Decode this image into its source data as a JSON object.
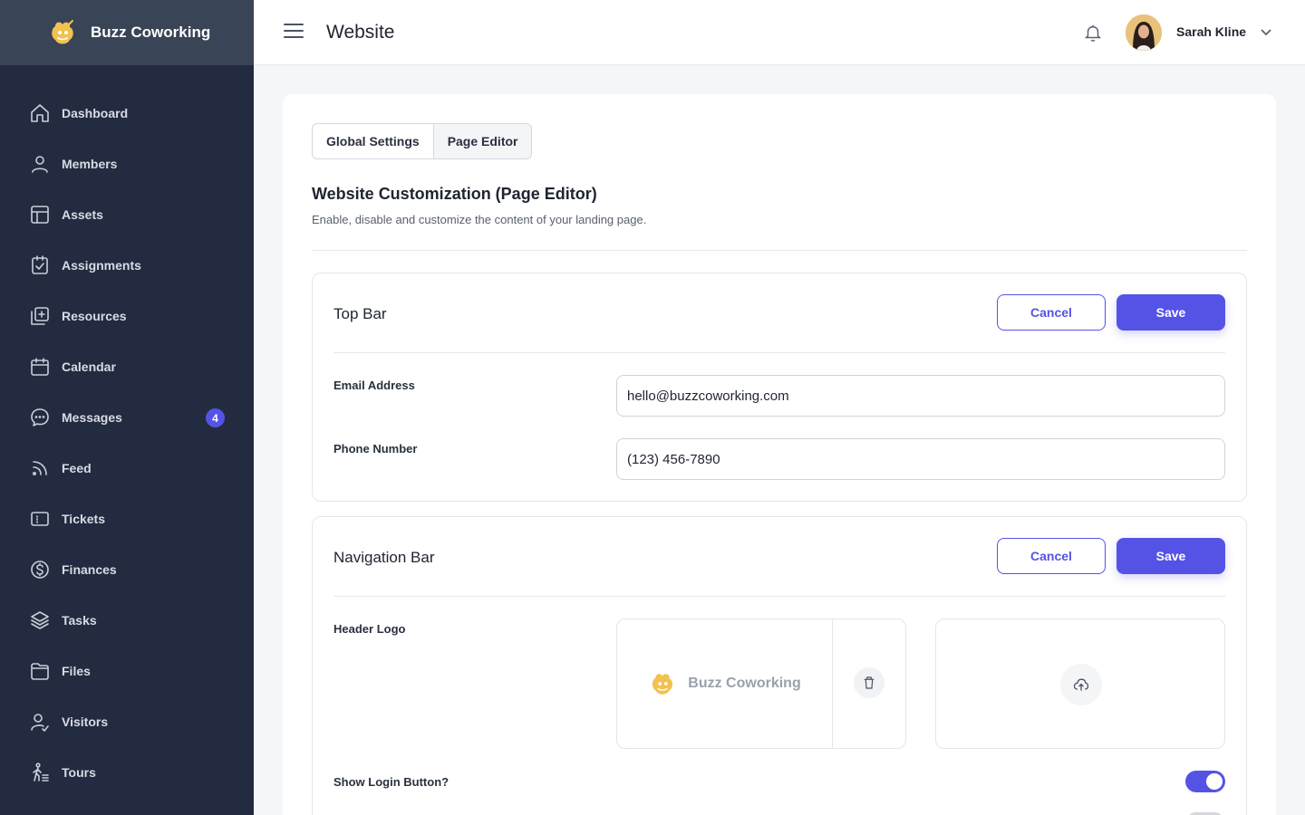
{
  "brand": {
    "name": "Buzz Coworking",
    "logo_icon": "bee-logo-icon",
    "accent_color": "#F2C14E"
  },
  "sidebar": {
    "items": [
      {
        "label": "Dashboard",
        "icon": "home-icon"
      },
      {
        "label": "Members",
        "icon": "user-icon"
      },
      {
        "label": "Assets",
        "icon": "layout-icon"
      },
      {
        "label": "Assignments",
        "icon": "clipboard-check-icon"
      },
      {
        "label": "Resources",
        "icon": "add-stack-icon"
      },
      {
        "label": "Calendar",
        "icon": "calendar-icon"
      },
      {
        "label": "Messages",
        "icon": "chat-icon",
        "badge": "4"
      },
      {
        "label": "Feed",
        "icon": "rss-icon"
      },
      {
        "label": "Tickets",
        "icon": "ticket-icon"
      },
      {
        "label": "Finances",
        "icon": "dollar-icon"
      },
      {
        "label": "Tasks",
        "icon": "layers-icon"
      },
      {
        "label": "Files",
        "icon": "folder-icon"
      },
      {
        "label": "Visitors",
        "icon": "user-check-icon"
      },
      {
        "label": "Tours",
        "icon": "walking-icon"
      }
    ]
  },
  "header": {
    "title": "Website",
    "user_name": "Sarah Kline"
  },
  "tabs": [
    {
      "label": "Global Settings",
      "active": false
    },
    {
      "label": "Page Editor",
      "active": true
    }
  ],
  "page": {
    "title": "Website Customization (Page Editor)",
    "description": "Enable, disable and customize the content of your landing page."
  },
  "top_bar": {
    "title": "Top Bar",
    "cancel_label": "Cancel",
    "save_label": "Save",
    "email_label": "Email Address",
    "email_value": "hello@buzzcoworking.com",
    "phone_label": "Phone Number",
    "phone_value": "(123) 456-7890"
  },
  "navigation_bar": {
    "title": "Navigation Bar",
    "cancel_label": "Cancel",
    "save_label": "Save",
    "header_logo_label": "Header Logo",
    "logo_preview_text": "Buzz Coworking",
    "show_login_label": "Show Login Button?",
    "show_login_enabled": true
  },
  "colors": {
    "primary": "#5553E6",
    "sidebar_bg": "#222B3F",
    "brand_bar_bg": "#3A4457"
  }
}
